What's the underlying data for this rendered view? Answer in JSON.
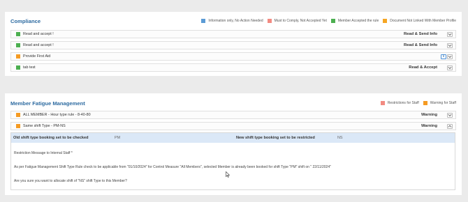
{
  "compliance": {
    "title": "Compliance",
    "legend": [
      {
        "label": "Information only, No Action Needed",
        "color": "#5b9bd5"
      },
      {
        "label": "Must to Comply, Not Accepted Yet",
        "color": "#f28b82"
      },
      {
        "label": "Member Accepted the rule",
        "color": "#4caf50"
      },
      {
        "label": "Document Not Linked With Member Profile",
        "color": "#f5a623"
      }
    ],
    "rows": [
      {
        "label": "Read and accept !",
        "action": "Read & Send Info",
        "color": "#4caf50"
      },
      {
        "label": "Read and accept !",
        "action": "Read & Send Info",
        "color": "#4caf50"
      },
      {
        "label": "Provide First Aid",
        "action": "",
        "color": "#f59b23"
      },
      {
        "label": "tab test",
        "action": "Read & Accept",
        "color": "#4caf50"
      }
    ]
  },
  "fatigue": {
    "title": "Member Fatigue Management",
    "legend": [
      {
        "label": "Restrictions for Staff",
        "color": "#f28b82"
      },
      {
        "label": "Warning for Staff",
        "color": "#f59b23"
      }
    ],
    "rows": [
      {
        "label": "ALL MEMBER - Hour type rule - 8-40-80",
        "action": "Warning",
        "color": "#f59b23"
      },
      {
        "label": "Same shift Type - PM-NS",
        "action": "Warning",
        "color": "#f59b23"
      }
    ],
    "detail": {
      "old_label": "Old shift type booking set to be checked",
      "old_value": "PM",
      "new_label": "New shift type booking set to be restricted",
      "new_value": "NS",
      "restriction_message": "Restriction Message to Internal Staff *",
      "rule_text": "As per Fatigue Management Shift Type Rule check to be applicable from \"01/10/2024\" for Control Measure \"All Members\", selected Member is already been booked for shift Type \"PM\" shift on \" 22/11/2024\"",
      "question": "Are you sure you want to allocate shift of \"NS\" shift Type to this Member?"
    }
  }
}
